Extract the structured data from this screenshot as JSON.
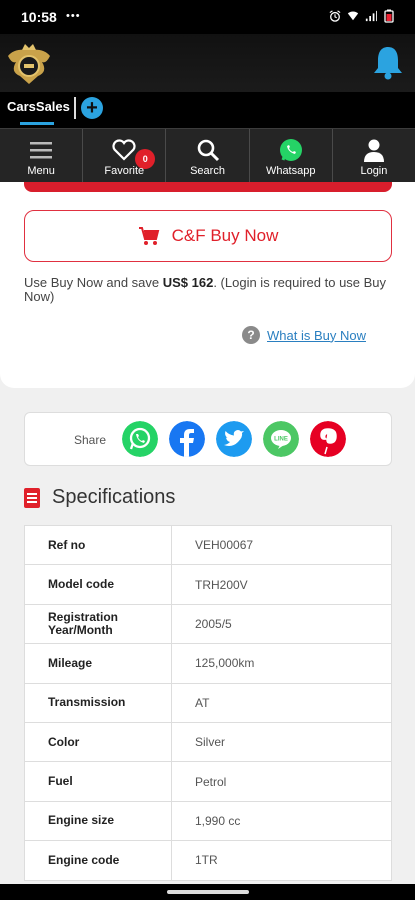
{
  "status": {
    "time": "10:58",
    "indicator": "•••",
    "icons": [
      "alarm-icon",
      "wifi-icon",
      "signal-icon",
      "battery-icon"
    ]
  },
  "header": {
    "logo": "carssales-logo",
    "notification_icon": "bell-icon"
  },
  "tabs": {
    "active": "CarsSales",
    "add_label": "+"
  },
  "nav": {
    "items": [
      {
        "label": "Menu",
        "icon": "menu-icon"
      },
      {
        "label": "Favorite",
        "icon": "heart-icon",
        "badge": "0"
      },
      {
        "label": "Search",
        "icon": "search-icon"
      },
      {
        "label": "Whatsapp",
        "icon": "whatsapp-icon"
      },
      {
        "label": "Login",
        "icon": "user-icon"
      }
    ]
  },
  "buy": {
    "button_label": "C&F Buy Now",
    "note_prefix": "Use Buy Now and save ",
    "note_amount": "US$ 162",
    "note_suffix": ". (Login is required to use Buy Now)",
    "help_link": "What is Buy Now",
    "help_icon_text": "?"
  },
  "share": {
    "label": "Share",
    "networks": [
      "whatsapp",
      "facebook",
      "twitter",
      "line",
      "pinterest"
    ]
  },
  "specs": {
    "title": "Specifications",
    "rows": [
      {
        "key": "Ref no",
        "value": "VEH00067"
      },
      {
        "key": "Model code",
        "value": "TRH200V"
      },
      {
        "key": "Registration Year/Month",
        "value": "2005/5"
      },
      {
        "key": "Mileage",
        "value": "125,000km"
      },
      {
        "key": "Transmission",
        "value": "AT"
      },
      {
        "key": "Color",
        "value": "Silver"
      },
      {
        "key": "Fuel",
        "value": "Petrol"
      },
      {
        "key": "Engine size",
        "value": "1,990 cc"
      },
      {
        "key": "Engine code",
        "value": "1TR"
      }
    ]
  },
  "colors": {
    "accent_red": "#e0202a",
    "accent_blue": "#2ba3e0",
    "link": "#2a7fc0"
  }
}
